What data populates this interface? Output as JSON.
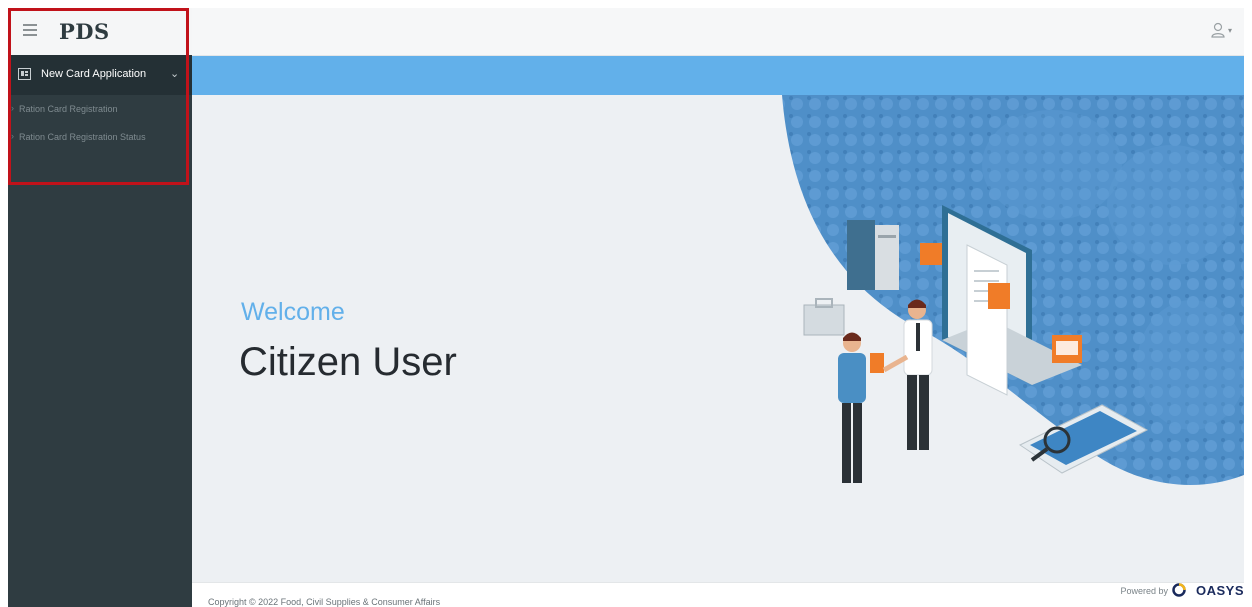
{
  "brand": {
    "name": "PDS",
    "menu_icon": "hamburger-icon"
  },
  "sidebar": {
    "menu": {
      "label": "New Card Application",
      "icon": "card-icon",
      "chevron": "⌄",
      "items": [
        {
          "label": "Ration Card Registration"
        },
        {
          "label": "Ration Card Registration Status"
        }
      ]
    }
  },
  "header": {
    "user_icon": "user-icon",
    "caret": "▾"
  },
  "main": {
    "welcome": "Welcome",
    "user_name": "Citizen User"
  },
  "footer": {
    "copyright": "Copyright © 2022 Food, Civil Supplies & Consumer Affairs",
    "powered_by": "Powered by",
    "vendor": "OASYS"
  },
  "colors": {
    "sidebar": "#2f3c41",
    "accent": "#62b0ea",
    "highlight": "#c1121a",
    "main_bg": "#edf0f3"
  }
}
